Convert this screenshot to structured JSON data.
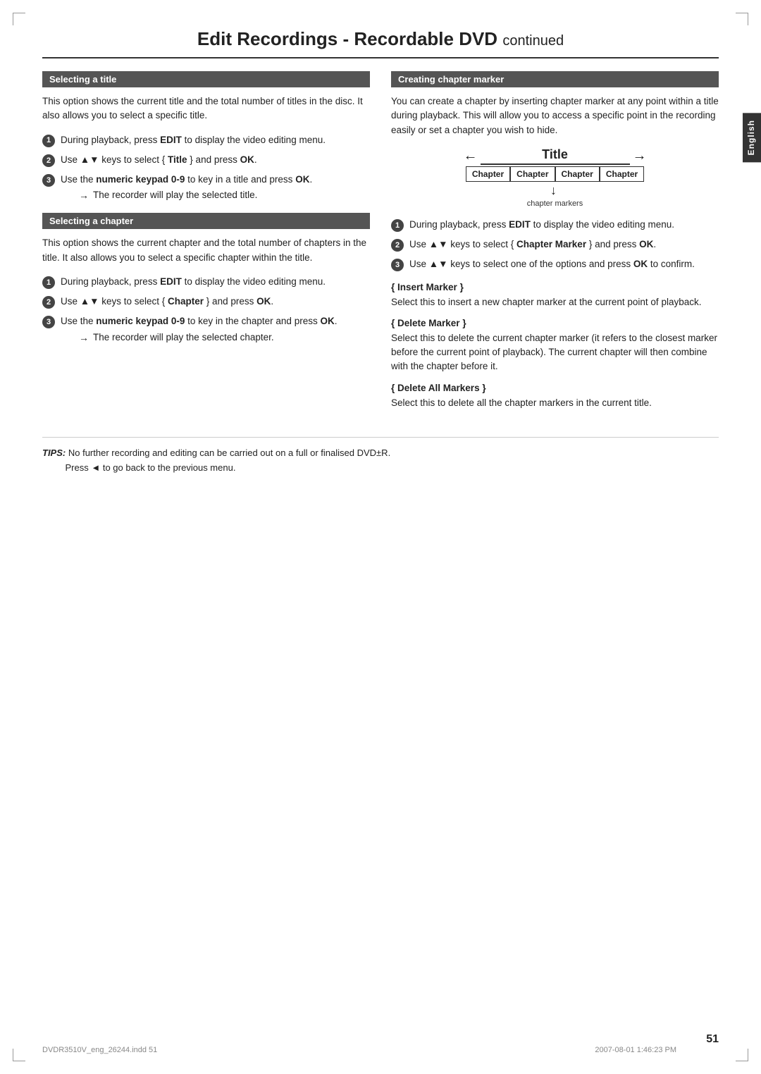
{
  "page": {
    "title": "Edit Recordings - Recordable DVD",
    "title_suffix": "continued",
    "page_number": "51",
    "footer_file": "DVDR3510V_eng_26244.indd  51",
    "footer_date": "2007-08-01  1:46:23 PM"
  },
  "english_tab": "English",
  "left_col": {
    "section1": {
      "header": "Selecting a title",
      "body": "This option shows the current title and the total number of titles in the disc. It also allows you to select a specific title.",
      "steps": [
        {
          "num": "1",
          "text_html": "During playback, press <b>EDIT</b> to display the video editing menu."
        },
        {
          "num": "2",
          "text_html": "Use ▲▼ keys to select { <b>Title</b> } and press <b>OK</b>."
        },
        {
          "num": "3",
          "text_html": "Use the <b>numeric keypad 0-9</b> to key in a title and press <b>OK</b>.",
          "result": "The recorder will play the selected title."
        }
      ]
    },
    "section2": {
      "header": "Selecting a chapter",
      "body": "This option shows the current chapter and the total number of chapters in the title. It also allows you to select a specific chapter within the title.",
      "steps": [
        {
          "num": "1",
          "text_html": "During playback, press <b>EDIT</b> to display the video editing menu."
        },
        {
          "num": "2",
          "text_html": "Use ▲▼ keys to select { <b>Chapter</b> } and press <b>OK</b>."
        },
        {
          "num": "3",
          "text_html": "Use the <b>numeric keypad 0-9</b> to key in the chapter and press <b>OK</b>.",
          "result": "The recorder will play the selected chapter."
        }
      ]
    }
  },
  "right_col": {
    "section1": {
      "header": "Creating chapter marker",
      "body": "You can create a chapter by inserting chapter marker at any point within a title during playback. This will allow you to access a specific point in the recording easily or set a chapter you wish to hide.",
      "diagram": {
        "title_label": "Title",
        "chapters": [
          "Chapter",
          "Chapter",
          "Chapter",
          "Chapter"
        ],
        "markers_label": "chapter markers"
      },
      "steps": [
        {
          "num": "1",
          "text_html": "During playback, press <b>EDIT</b> to display the video editing menu."
        },
        {
          "num": "2",
          "text_html": "Use ▲▼ keys to select { <b>Chapter Marker</b> } and press <b>OK</b>."
        },
        {
          "num": "3",
          "text_html": "Use ▲▼ keys to select one of the options and press <b>OK</b> to confirm."
        }
      ],
      "sub_sections": [
        {
          "title": "{ Insert Marker }",
          "body": "Select this to insert a new chapter marker at the current point of playback."
        },
        {
          "title": "{ Delete Marker }",
          "body": "Select this to delete the current chapter marker (it refers to the closest marker before the current point of playback). The current chapter will then combine with the chapter before it."
        },
        {
          "title": "{ Delete All Markers }",
          "body": "Select this to delete all the chapter markers in the current title."
        }
      ]
    }
  },
  "tips": {
    "label": "TIPS:",
    "text": "No further recording and editing can be carried out on a full or finalised DVD±R.",
    "text2": "Press ◄ to go back to the previous menu."
  }
}
